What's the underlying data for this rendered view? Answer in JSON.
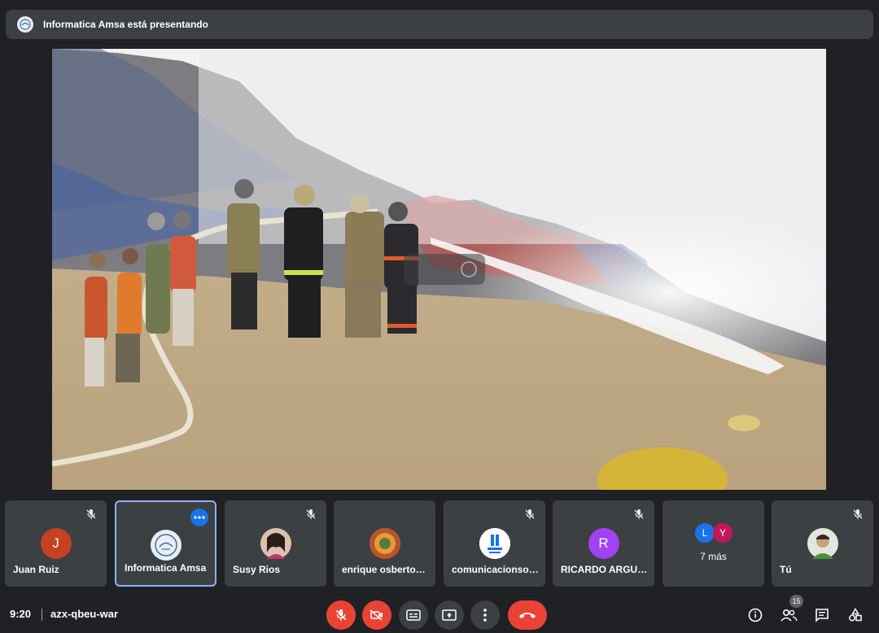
{
  "banner": {
    "text": "Informatica Amsa está presentando",
    "icon": "presenter-avatar-icon"
  },
  "stage": {
    "content": "shared-screen-photo"
  },
  "participants": [
    {
      "name": "Juan Ruiz",
      "initial": "J",
      "avatar_color": "#c5411f",
      "muted": true
    },
    {
      "name": "Informatica Amsa",
      "initial": "AMSA",
      "avatar_color": "#e8eef3",
      "muted": false,
      "active": true
    },
    {
      "name": "Susy Rios",
      "initial": "",
      "avatar_color": "#6b4b3a",
      "muted": true
    },
    {
      "name": "enrique osberto…",
      "initial": "",
      "avatar_color": "#c96a2b",
      "muted": false
    },
    {
      "name": "comunicacionso…",
      "initial": "",
      "avatar_color": "#ffffff",
      "muted": true
    },
    {
      "name": "RICARDO ARGU…",
      "initial": "R",
      "avatar_color": "#a142f4",
      "muted": true
    },
    {
      "name": "",
      "more_label": "7 más",
      "mini": [
        {
          "initial": "L",
          "color": "#1a73e8"
        },
        {
          "initial": "Y",
          "color": "#c2185b"
        }
      ]
    },
    {
      "name": "Tú",
      "initial": "",
      "avatar_color": "#6f8a55",
      "muted": true
    }
  ],
  "bottombar": {
    "time": "9:20",
    "meeting_code": "azx-qbeu-war",
    "people_count": "15"
  },
  "colors": {
    "background": "#202124",
    "tile": "#3c4043",
    "danger": "#ea4335",
    "accent": "#8ab4f8"
  }
}
